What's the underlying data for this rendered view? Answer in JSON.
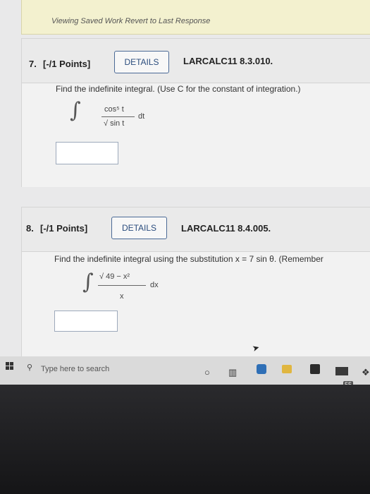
{
  "banner": {
    "text": "Viewing Saved Work Revert to Last Response"
  },
  "questions": [
    {
      "number": "7.",
      "points": "[-/1 Points]",
      "details_label": "DETAILS",
      "reference": "LARCALC11 8.3.010.",
      "prompt": "Find the indefinite integral. (Use C for the constant of integration.)",
      "math": {
        "integral_sign": "∫",
        "numerator": "cos⁵ t",
        "denominator": "√ sin t",
        "differential": "dt"
      },
      "answer_value": ""
    },
    {
      "number": "8.",
      "points": "[-/1 Points]",
      "details_label": "DETAILS",
      "reference": "LARCALC11 8.4.005.",
      "prompt": "Find the indefinite integral using the substitution x = 7 sin θ. (Remember",
      "math": {
        "integral_sign": "∫",
        "numerator": "√ 49 − x²",
        "denominator": "x",
        "differential": "dx"
      },
      "answer_value": ""
    }
  ],
  "taskbar": {
    "search_placeholder": "Type here to search",
    "badge_count": "55",
    "icons": [
      "windows-icon",
      "search-icon",
      "cortana-icon",
      "task-view-icon",
      "edge-icon",
      "file-explorer-icon",
      "store-icon",
      "mail-icon",
      "dropbox-icon"
    ]
  }
}
